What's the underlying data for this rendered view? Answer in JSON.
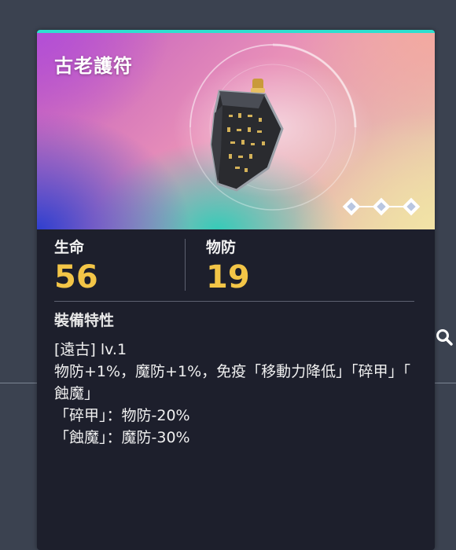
{
  "item": {
    "name": "古老護符",
    "rarity_count": 3
  },
  "stats": [
    {
      "label": "生命",
      "value": "56"
    },
    {
      "label": "物防",
      "value": "19"
    }
  ],
  "traits": {
    "title": "裝備特性",
    "lines": [
      "[遠古] lv.1",
      "物防+1%，魔防+1%，免疫「移動力降低」「碎甲」「",
      "蝕魔」",
      "「碎甲」：物防-20%",
      "「蝕魔」：魔防-30%"
    ]
  },
  "colors": {
    "accent": "#2ee0d0",
    "stat_value": "#f3c547",
    "card_bg": "#1d1f2c",
    "page_bg": "#3b4250"
  },
  "icons": {
    "side": "search-icon",
    "rarity": "diamond-icon"
  }
}
